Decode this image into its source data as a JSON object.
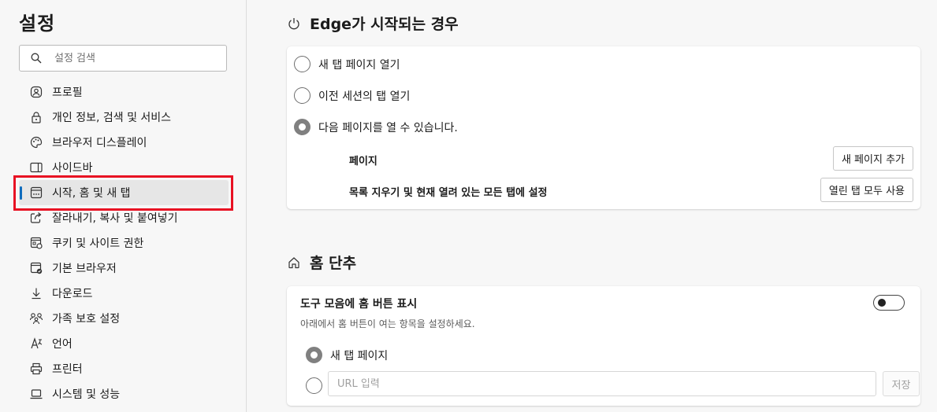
{
  "sidebar": {
    "title": "설정",
    "search_placeholder": "설정 검색",
    "items": [
      {
        "label": "프로필",
        "icon": "profile-icon"
      },
      {
        "label": "개인 정보, 검색 및 서비스",
        "icon": "lock-icon"
      },
      {
        "label": "브라우저 디스플레이",
        "icon": "palette-icon"
      },
      {
        "label": "사이드바",
        "icon": "sidebar-icon"
      },
      {
        "label": "시작, 홈 및 새 탭",
        "icon": "start-home-icon",
        "active": true
      },
      {
        "label": "잘라내기, 복사 및 붙여넣기",
        "icon": "share-icon"
      },
      {
        "label": "쿠키 및 사이트 권한",
        "icon": "cookie-icon"
      },
      {
        "label": "기본 브라우저",
        "icon": "default-browser-icon"
      },
      {
        "label": "다운로드",
        "icon": "download-icon"
      },
      {
        "label": "가족 보호 설정",
        "icon": "family-icon"
      },
      {
        "label": "언어",
        "icon": "language-icon"
      },
      {
        "label": "프린터",
        "icon": "printer-icon"
      },
      {
        "label": "시스템 및 성능",
        "icon": "laptop-icon"
      }
    ]
  },
  "startup": {
    "title": "Edge가 시작되는 경우",
    "icon": "power-icon",
    "options": {
      "new_tab": "새 탭 페이지 열기",
      "previous_session": "이전 세션의 탭 열기",
      "specific_pages": "다음 페이지를 열 수 있습니다."
    },
    "selected": "specific_pages",
    "pages_label": "페이지",
    "add_page_button": "새 페이지 추가",
    "clear_label": "목록 지우기 및 현재 열려 있는 모든 탭에 설정",
    "use_all_tabs_button": "열린 탭 모두 사용"
  },
  "home": {
    "title": "홈 단추",
    "icon": "home-icon",
    "toggle_label": "도구 모음에 홈 버튼 표시",
    "toggle_on": false,
    "description": "아래에서 홈 버튼이 여는 항목을 설정하세요.",
    "new_tab_option": "새 탭 페이지",
    "url_placeholder": "URL 입력",
    "save_button": "저장"
  },
  "colors": {
    "accent": "#0f6cbd",
    "highlight": "#e81123"
  }
}
